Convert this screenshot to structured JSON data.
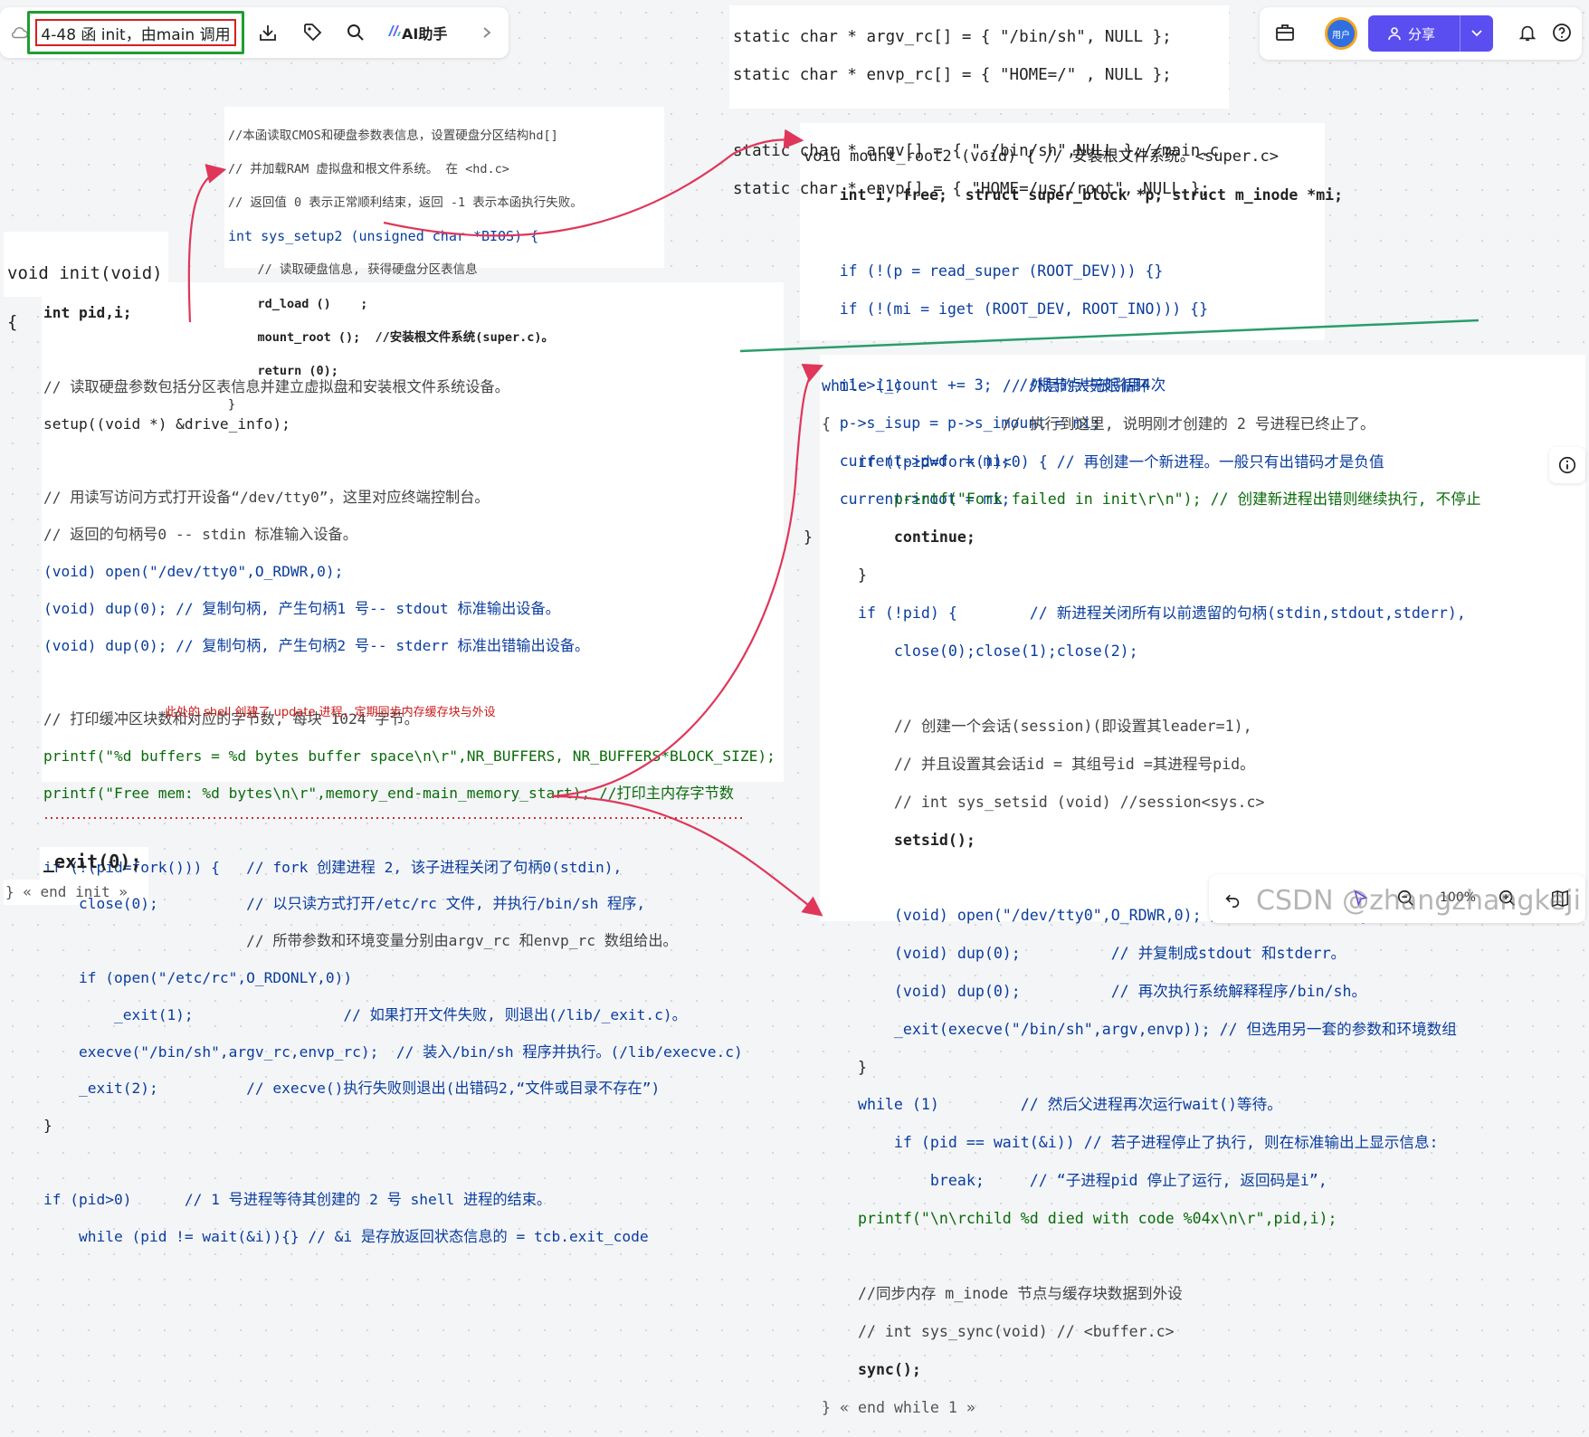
{
  "toolbar": {
    "doc_title": "4-48 函 init，由main 调用",
    "ai_label": "AI助手",
    "icons": [
      "cloud-icon",
      "download-icon",
      "tag-icon",
      "search-icon",
      "ai-logo-icon",
      "chevron-right-icon"
    ]
  },
  "right_toolbar": {
    "avatar_label": "用户",
    "share_label": "分享",
    "icons": [
      "briefcase-icon",
      "person-icon",
      "chevron-down-icon",
      "bell-icon",
      "help-icon"
    ]
  },
  "bottom_toolbar": {
    "zoom": "100%",
    "icons": [
      "undo-icon",
      "cursor-icon",
      "zoom-out-icon",
      "zoom-in-icon",
      "map-icon"
    ]
  },
  "watermark": "CSDN @zhangzhangkeji",
  "colors": {
    "accent": "#5b4ef0",
    "arrow": "#e0365a",
    "green_line": "#2a9d6a",
    "title_outline_green": "#1e9e2e",
    "title_outline_red": "#d61f1f"
  },
  "argv_block": [
    "static char * argv_rc[] = { \"/bin/sh\", NULL };",
    "static char * envp_rc[] = { \"HOME=/\" , NULL };",
    "",
    "static char * argv[] = { \"-/bin/sh\",NULL };//main.c",
    "static char * envp[] = { \"HOME=/usr/root\", NULL };"
  ],
  "setup_block": [
    "//本函读取CMOS和硬盘参数表信息，设置硬盘分区结构hd[]",
    "// 并加载RAM 虚拟盘和根文件系统。 在 <hd.c>",
    "// 返回值 0 表示正常顺利结束，返回 -1 表示本函执行失败。",
    "int sys_setup2 (unsigned char *BIOS) {",
    "    // 读取硬盘信息, 获得硬盘分区表信息",
    "    rd_load ()    ;",
    "    mount_root ();  //安装根文件系统(super.c)。",
    "    return (0);",
    "}"
  ],
  "mount_block": [
    "void mount_root2 (void) { // 安装根文件系统。<super.c>",
    "    int i, free;  struct super_block *p; struct m_inode *mi;",
    "",
    "    if (!(p = read_super (ROOT_DEV))) {}",
    "    if (!(mi = iget (ROOT_DEV, ROOT_INO))) {}",
    "",
    "    mi->i_count += 3;   //根节点共被引用4次",
    "    p->s_isup = p->s_imount = mi;",
    "    current->pwd  = mi;",
    "    current->root = mi;",
    "}"
  ],
  "init_header": [
    "void init(void)",
    "{"
  ],
  "init_block": [
    "int pid,i;",
    "",
    "// 读取硬盘参数包括分区表信息并建立虚拟盘和安装根文件系统设备。",
    "setup((void *) &drive_info);",
    "",
    "// 用读写访问方式打开设备“/dev/tty0”，这里对应终端控制台。",
    "// 返回的句柄号0 -- stdin 标准输入设备。",
    "(void) open(\"/dev/tty0\",O_RDWR,0);",
    "(void) dup(0); // 复制句柄, 产生句柄1 号-- stdout 标准输出设备。",
    "(void) dup(0); // 复制句柄, 产生句柄2 号-- stderr 标准出错输出设备。",
    "",
    "// 打印缓冲区块数和对应的字节数, 每块 1024 字节。",
    "printf(\"%d buffers = %d bytes buffer space\\n\\r\",NR_BUFFERS, NR_BUFFERS*BLOCK_SIZE);",
    "printf(\"Free mem: %d bytes\\n\\r\",memory_end-main_memory_start); //打印主内存字节数",
    "",
    "if (!(pid=fork())) {   // fork 创建进程 2, 该子进程关闭了句柄0(stdin),",
    "    close(0);          // 以只读方式打开/etc/rc 文件, 并执行/bin/sh 程序,",
    "                       // 所带参数和环境变量分别由argv_rc 和envp_rc 数组给出。",
    "    if (open(\"/etc/rc\",O_RDONLY,0))",
    "        _exit(1);                 // 如果打开文件失败, 则退出(/lib/_exit.c)。",
    "    execve(\"/bin/sh\",argv_rc,envp_rc);  // 装入/bin/sh 程序并执行。(/lib/execve.c)",
    "    _exit(2);          // execve()执行失败则退出(出错码2,“文件或目录不存在”)",
    "}",
    "",
    "if (pid>0)      // 1 号进程等待其创建的 2 号 shell 进程的结束。",
    "    while (pid != wait(&i)){} // &i 是存放返回状态信息的 = tcb.exit_code"
  ],
  "init_note": "此处的 shell 创建了 update 进程，定期同步内存缓存块与外设",
  "init_exit": "_exit(0);",
  "init_end": "} « end init »",
  "while_block": [
    "while (1)           // 外层的大无限循环",
    "{                   // 执行到这里, 说明刚才创建的 2 号进程已终止了。",
    "    if ((pid=fork())<0) { // 再创建一个新进程。一般只有出错码才是负值",
    "        printf(\"Fork failed in init\\r\\n\"); // 创建新进程出错则继续执行, 不停止",
    "        continue;",
    "    }",
    "    if (!pid) {        // 新进程关闭所有以前遗留的句柄(stdin,stdout,stderr),",
    "        close(0);close(1);close(2);",
    "",
    "        // 创建一个会话(session)(即设置其leader=1),",
    "        // 并且设置其会话id = 其组号id =其进程号pid。",
    "        // int sys_setsid (void) //session<sys.c>",
    "        setsid();",
    "",
    "        (void) open(\"/dev/tty0\",O_RDWR,0); // 重新打开/dev/tty0 作为stdin,",
    "        (void) dup(0);          // 并复制成stdout 和stderr。",
    "        (void) dup(0);          // 再次执行系统解释程序/bin/sh。",
    "        _exit(execve(\"/bin/sh\",argv,envp)); // 但选用另一套的参数和环境数组",
    "    }",
    "    while (1)         // 然后父进程再次运行wait()等待。",
    "        if (pid == wait(&i)) // 若子进程停止了执行, 则在标准输出上显示信息:",
    "            break;     // “子进程pid 停止了运行, 返回码是i”,",
    "    printf(\"\\n\\rchild %d died with code %04x\\n\\r\",pid,i);",
    "",
    "    //同步内存 m_inode 节点与缓存块数据到外设",
    "    // int sys_sync(void) // <buffer.c>",
    "    sync();",
    "} « end while 1 »"
  ]
}
